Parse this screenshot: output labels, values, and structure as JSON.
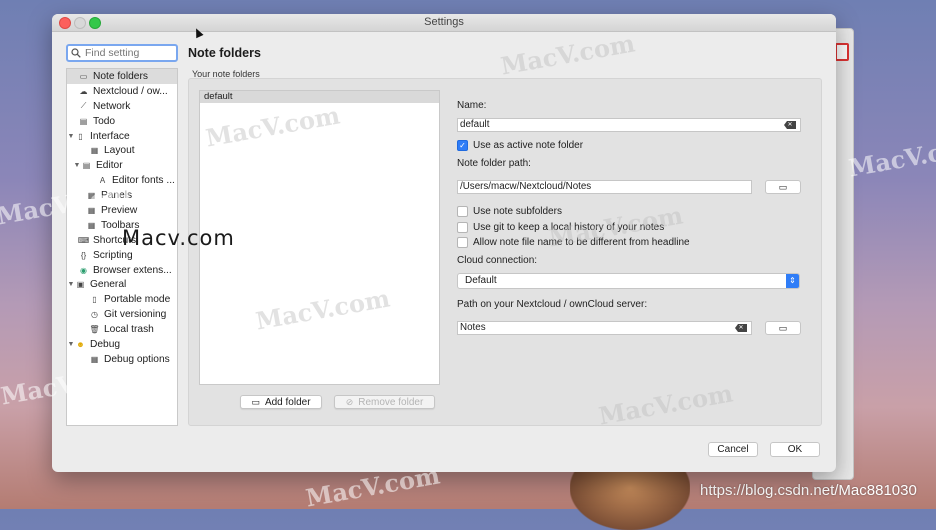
{
  "window": {
    "title": "Settings"
  },
  "search": {
    "placeholder": "Find setting"
  },
  "sidebar": {
    "items": [
      {
        "label": "Note folders",
        "icon": "folder-icon"
      },
      {
        "label": "Nextcloud / ow...",
        "icon": "cloud-icon"
      },
      {
        "label": "Network",
        "icon": "network-icon"
      },
      {
        "label": "Todo",
        "icon": "todo-icon"
      },
      {
        "label": "Interface",
        "icon": "interface-icon"
      },
      {
        "label": "Layout",
        "icon": "layout-icon"
      },
      {
        "label": "Editor",
        "icon": "editor-icon"
      },
      {
        "label": "Editor fonts ...",
        "icon": "font-icon"
      },
      {
        "label": "Panels",
        "icon": "panels-icon"
      },
      {
        "label": "Preview",
        "icon": "preview-icon"
      },
      {
        "label": "Toolbars",
        "icon": "toolbar-icon"
      },
      {
        "label": "Shortcuts",
        "icon": "shortcuts-icon"
      },
      {
        "label": "Scripting",
        "icon": "scripting-icon"
      },
      {
        "label": "Browser extens...",
        "icon": "browser-icon"
      },
      {
        "label": "General",
        "icon": "general-icon"
      },
      {
        "label": "Portable mode",
        "icon": "portable-icon"
      },
      {
        "label": "Git versioning",
        "icon": "git-icon"
      },
      {
        "label": "Local trash",
        "icon": "trash-icon"
      },
      {
        "label": "Debug",
        "icon": "debug-icon"
      },
      {
        "label": "Debug options",
        "icon": "debug-options-icon"
      }
    ]
  },
  "main": {
    "title": "Note folders",
    "section_label": "Your note folders",
    "folders": [
      "default"
    ],
    "add_folder": "Add folder",
    "remove_folder": "Remove folder",
    "name_label": "Name:",
    "name_value": "default",
    "active_label": "Use as active note folder",
    "path_label": "Note folder path:",
    "path_value": "/Users/macw/Nextcloud/Notes",
    "subfolders_label": "Use note subfolders",
    "git_label": "Use git to keep a local history of your notes",
    "filename_label": "Allow note file name to be different from headline",
    "cloud_label": "Cloud connection:",
    "cloud_value": "Default",
    "server_path_label": "Path on your Nextcloud / ownCloud server:",
    "server_path_value": "Notes"
  },
  "dialog": {
    "cancel": "Cancel",
    "ok": "OK"
  },
  "overlay": {
    "watermark": "MacV.com",
    "macv_text": "Macv.com",
    "csdn": "https://blog.csdn.net/Mac881030"
  },
  "colors": {
    "accent": "#2f7df7",
    "selected": "#dcdcdc"
  }
}
